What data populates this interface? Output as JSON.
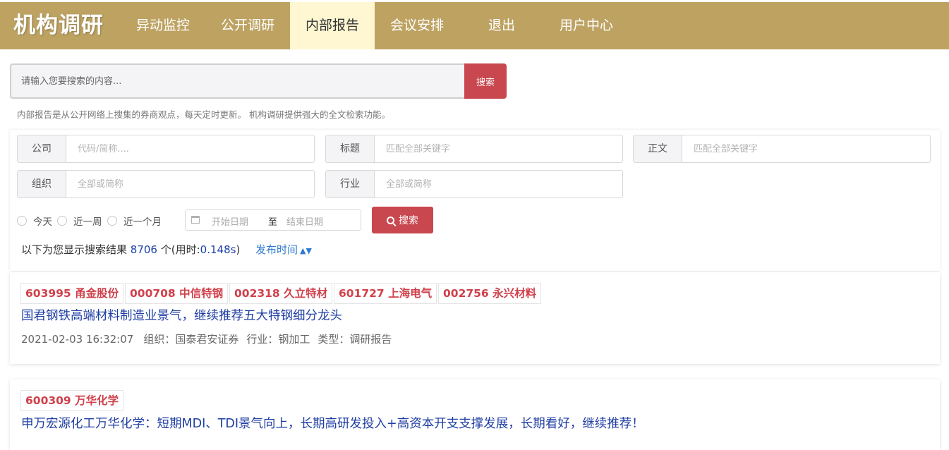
{
  "nav": {
    "logo": "机构调研",
    "items": [
      "异动监控",
      "公开调研",
      "内部报告",
      "会议安排",
      "退出",
      "用户中心"
    ],
    "active_index": 2,
    "colors": {
      "bar": "#bda262",
      "active": "#fff7d2"
    }
  },
  "search": {
    "placeholder": "请输入您要搜索的内容...",
    "button_label": "搜索",
    "hint": "内部报告是从公开网络上搜集的券商观点，每天定时更新。 机构调研提供强大的全文检索功能。"
  },
  "filters": {
    "company": {
      "label": "公司",
      "placeholder": "代码/简称...."
    },
    "title": {
      "label": "标题",
      "placeholder": "匹配全部关键字"
    },
    "body": {
      "label": "正文",
      "placeholder": "匹配全部关键字"
    },
    "org": {
      "label": "组织",
      "placeholder": "全部或简称"
    },
    "industry": {
      "label": "行业",
      "placeholder": "全部或简称"
    },
    "periods": [
      "今天",
      "近一周",
      "近一个月"
    ],
    "date_start_placeholder": "开始日期",
    "date_separator": "至",
    "date_end_placeholder": "结束日期",
    "search_label": "搜索"
  },
  "results": {
    "prefix": "以下为您显示搜索结果",
    "count": "8706",
    "suffix_unit": "个(用时:",
    "time": "0.148s",
    "suffix_close": ")",
    "sort_label": "发布时间",
    "sort_icon": "sort-updown-icon"
  },
  "items": [
    {
      "tags": [
        "603995 甬金股份",
        "000708 中信特钢",
        "002318 久立特材",
        "601727 上海电气",
        "002756 永兴材料"
      ],
      "title": "国君钢铁高端材料制造业景气，继续推荐五大特钢细分龙头",
      "date": "2021-02-03 16:32:07",
      "org": "组织：国泰君安证券",
      "industry": "行业：钢加工",
      "type": "类型：调研报告"
    },
    {
      "tags": [
        "600309 万华化学"
      ],
      "title": "申万宏源化工万华化学：短期MDI、TDI景气向上，长期高研发投入+高资本开支支撑发展，长期看好，继续推荐！"
    }
  ]
}
